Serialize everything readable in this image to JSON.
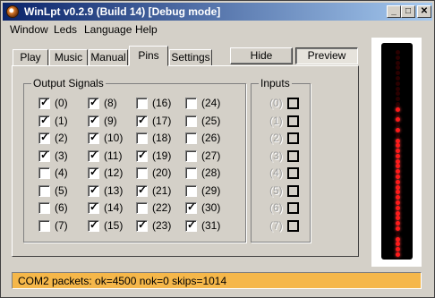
{
  "window": {
    "title": "WinLpt v0.2.9 (Build 14) [Debug mode]"
  },
  "titlebar_buttons": {
    "minimize": "_",
    "maximize": "□",
    "close": "✕"
  },
  "menu": [
    "Window",
    "Leds",
    "Language",
    "Help"
  ],
  "tabs": [
    {
      "label": "Play",
      "active": false
    },
    {
      "label": "Music",
      "active": false
    },
    {
      "label": "Manual",
      "active": false
    },
    {
      "label": "Pins",
      "active": true
    },
    {
      "label": "Settings",
      "active": false
    }
  ],
  "buttons": {
    "hide": "Hide",
    "preview": "Preview"
  },
  "output_group": {
    "label": "Output Signals",
    "signals": [
      {
        "label": "(0)",
        "checked": true
      },
      {
        "label": "(1)",
        "checked": true
      },
      {
        "label": "(2)",
        "checked": true
      },
      {
        "label": "(3)",
        "checked": true
      },
      {
        "label": "(4)",
        "checked": false
      },
      {
        "label": "(5)",
        "checked": false
      },
      {
        "label": "(6)",
        "checked": false
      },
      {
        "label": "(7)",
        "checked": false
      },
      {
        "label": "(8)",
        "checked": true
      },
      {
        "label": "(9)",
        "checked": true
      },
      {
        "label": "(10)",
        "checked": true
      },
      {
        "label": "(11)",
        "checked": true
      },
      {
        "label": "(12)",
        "checked": true
      },
      {
        "label": "(13)",
        "checked": true
      },
      {
        "label": "(14)",
        "checked": true
      },
      {
        "label": "(15)",
        "checked": true
      },
      {
        "label": "(16)",
        "checked": false
      },
      {
        "label": "(17)",
        "checked": true
      },
      {
        "label": "(18)",
        "checked": false
      },
      {
        "label": "(19)",
        "checked": true
      },
      {
        "label": "(20)",
        "checked": false
      },
      {
        "label": "(21)",
        "checked": true
      },
      {
        "label": "(22)",
        "checked": false
      },
      {
        "label": "(23)",
        "checked": true
      },
      {
        "label": "(24)",
        "checked": false
      },
      {
        "label": "(25)",
        "checked": false
      },
      {
        "label": "(26)",
        "checked": false
      },
      {
        "label": "(27)",
        "checked": false
      },
      {
        "label": "(28)",
        "checked": false
      },
      {
        "label": "(29)",
        "checked": false
      },
      {
        "label": "(30)",
        "checked": true
      },
      {
        "label": "(31)",
        "checked": true
      }
    ]
  },
  "inputs_group": {
    "label": "Inputs",
    "items": [
      "(0)",
      "(1)",
      "(2)",
      "(3)",
      "(4)",
      "(5)",
      "(6)",
      "(7)"
    ]
  },
  "status": "COM2 packets: ok=4500 nok=0 skips=1014",
  "leds": [
    0,
    0,
    0,
    0,
    0,
    0,
    0,
    0,
    0,
    0,
    0,
    1,
    0,
    1,
    0,
    1,
    0,
    1,
    1,
    1,
    1,
    1,
    1,
    1,
    1,
    1,
    1,
    1,
    1,
    1,
    1,
    1,
    1,
    1,
    1,
    0,
    1,
    1,
    1,
    1
  ],
  "colors": {
    "status_bg": "#f5b74a",
    "led_on": "#ff1a1a",
    "titlebar_start": "#0a246a",
    "titlebar_end": "#a6caf0"
  }
}
